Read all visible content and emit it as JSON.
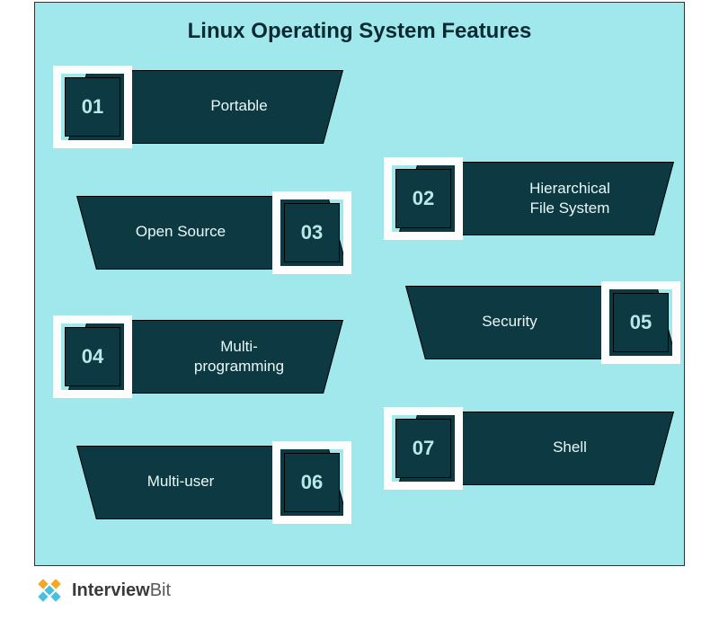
{
  "title": "Linux Operating System Features",
  "features": {
    "f1": {
      "num": "01",
      "label": "Portable"
    },
    "f2": {
      "num": "02",
      "label": "Hierarchical\nFile System"
    },
    "f3": {
      "num": "03",
      "label": "Open Source"
    },
    "f4": {
      "num": "04",
      "label": "Multi-\nprogramming"
    },
    "f5": {
      "num": "05",
      "label": "Security"
    },
    "f6": {
      "num": "06",
      "label": "Multi-user"
    },
    "f7": {
      "num": "07",
      "label": "Shell"
    }
  },
  "brand": {
    "name1": "Interview",
    "name2": "Bit"
  },
  "colors": {
    "background": "#a0e8ec",
    "bar": "#0d3a42",
    "frame": "#fdfdfd",
    "number_text": "#b8e8e8",
    "label_text": "#e8f8f8",
    "logo_orange": "#f5a623",
    "logo_blue": "#4ac0e0"
  }
}
